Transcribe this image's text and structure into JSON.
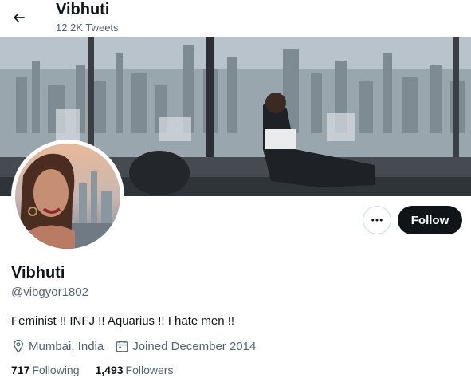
{
  "header": {
    "title": "Vibhuti",
    "subtitle": "12.2K Tweets",
    "back_icon": "arrow-left-icon"
  },
  "profile": {
    "display_name": "Vibhuti",
    "handle": "@vibgyor1802",
    "bio": "Feminist !! INFJ !! Aquarius !! I hate men !!",
    "location": "Mumbai, India",
    "joined": "Joined December 2014"
  },
  "actions": {
    "more_icon": "more-horizontal-icon",
    "follow_label": "Follow"
  },
  "stats": {
    "following_count": "717",
    "following_label": "Following",
    "followers_count": "1,493",
    "followers_label": "Followers"
  },
  "colors": {
    "text_primary": "#0f1419",
    "text_secondary": "#536471",
    "follow_bg": "#0f1419",
    "border": "#cfd9de"
  }
}
